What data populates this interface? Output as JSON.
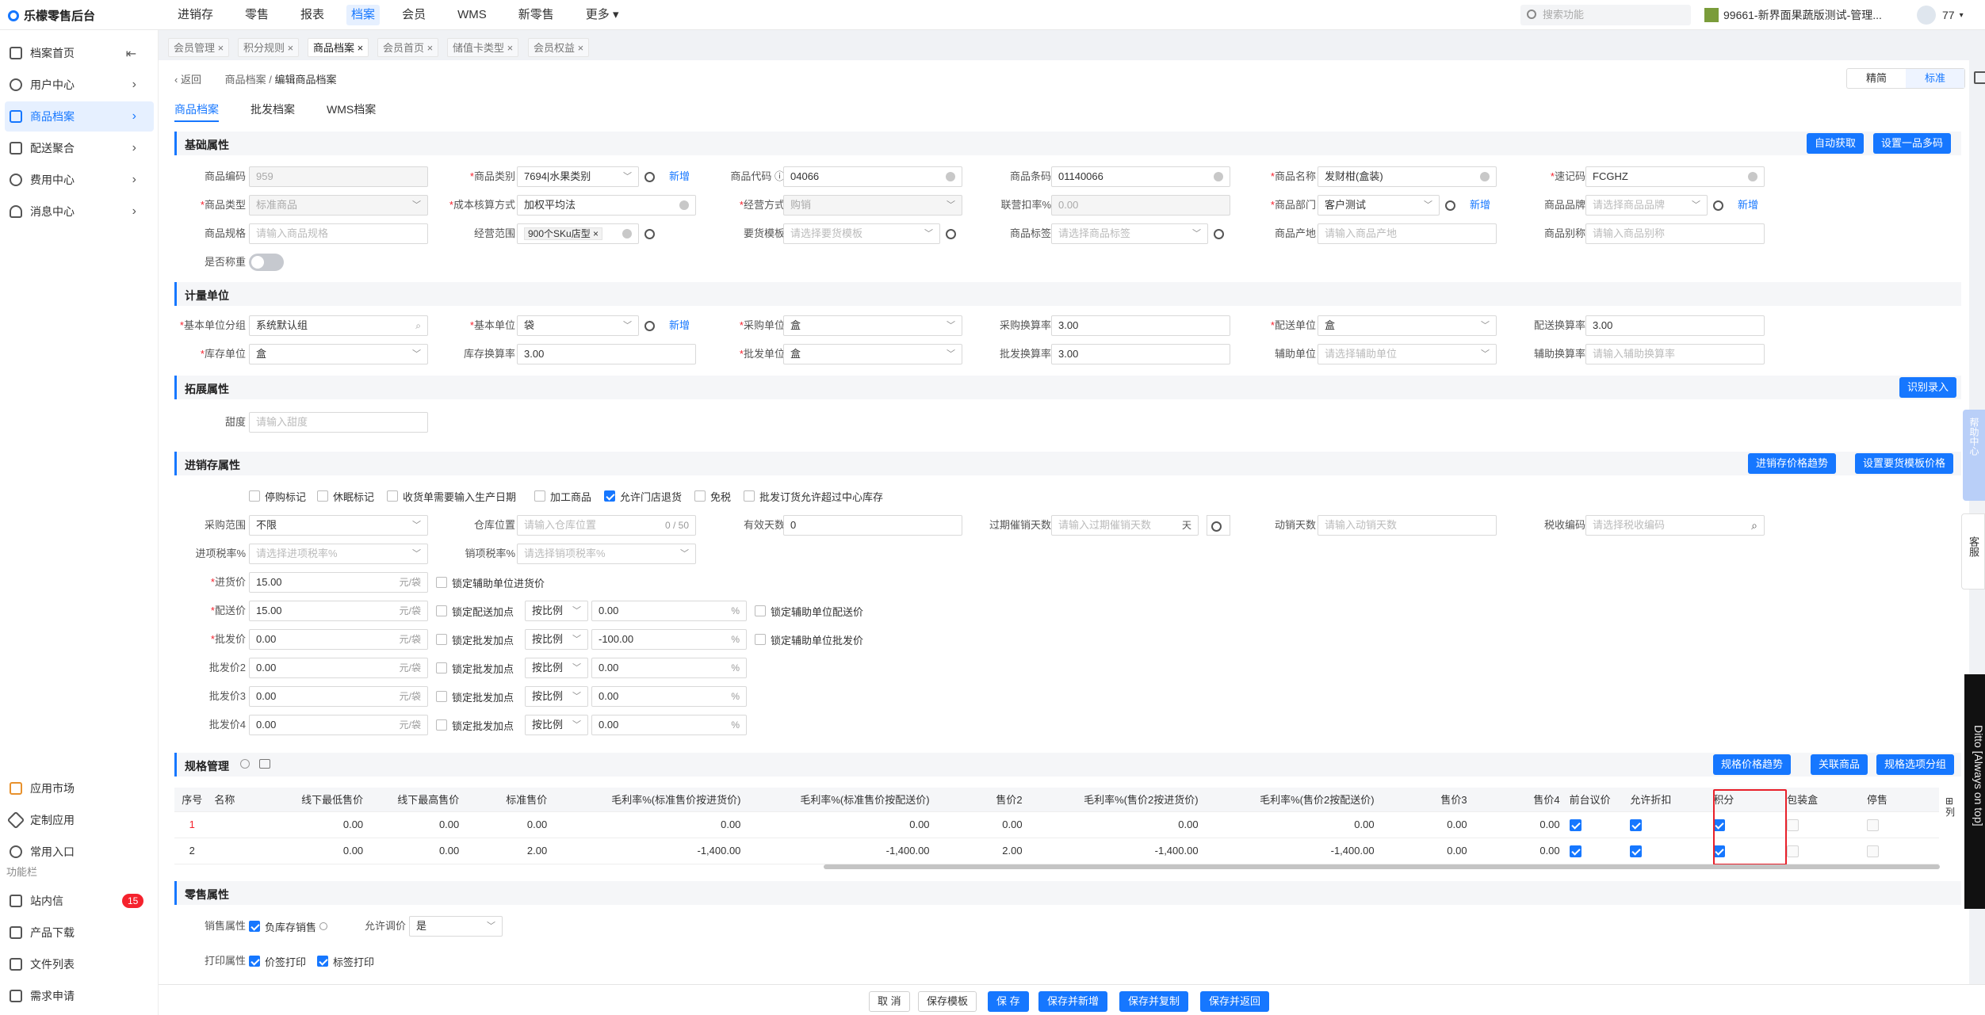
{
  "app": {
    "title": "乐檬零售后台"
  },
  "topnav": [
    "进销存",
    "零售",
    "报表",
    "档案",
    "会员",
    "WMS",
    "新零售",
    "更多"
  ],
  "topnav_active": "档案",
  "search": {
    "placeholder": "搜索功能"
  },
  "store": {
    "name": "99661-新界面果蔬版测试-管理..."
  },
  "user": {
    "name": "77"
  },
  "sidebar": {
    "items": [
      {
        "label": "档案首页"
      },
      {
        "label": "用户中心"
      },
      {
        "label": "商品档案"
      },
      {
        "label": "配送聚合"
      },
      {
        "label": "费用中心"
      },
      {
        "label": "消息中心"
      }
    ],
    "bottom": [
      {
        "label": "应用市场"
      },
      {
        "label": "定制应用"
      },
      {
        "label": "常用入口"
      }
    ],
    "section_label": "功能栏",
    "tools": [
      {
        "label": "站内信",
        "badge": "15"
      },
      {
        "label": "产品下载"
      },
      {
        "label": "文件列表"
      },
      {
        "label": "需求申请"
      }
    ]
  },
  "tabs": [
    "会员管理",
    "积分规则",
    "商品档案",
    "会员首页",
    "储值卡类型",
    "会员权益"
  ],
  "tabs_active": "商品档案",
  "breadcrumb": {
    "back": "返回",
    "parent": "商品档案",
    "sep": "/",
    "current": "编辑商品档案"
  },
  "view_switch": {
    "simple": "精简",
    "standard": "标准"
  },
  "subtabs": [
    "商品档案",
    "批发档案",
    "WMS档案"
  ],
  "sections": {
    "basic": "基础属性",
    "unit": "计量单位",
    "ext": "拓展属性",
    "inv": "进销存属性",
    "spec": "规格管理",
    "retail": "零售属性"
  },
  "buttons": {
    "auto_get": "自动获取",
    "set_multi_code": "设置一品多码",
    "ocr_input": "识别录入",
    "price_trend": "进销存价格趋势",
    "set_template_price": "设置要货模板价格",
    "spec_price_trend": "规格价格趋势",
    "related_goods": "关联商品",
    "spec_option_group": "规格选项分组",
    "add_new": "新增"
  },
  "basic": {
    "code_label": "商品编码",
    "code": "959",
    "category_label": "商品类别",
    "category": "7694|水果类别",
    "gcode_label": "商品代码",
    "gcode": "04066",
    "barcode_label": "商品条码",
    "barcode": "01140066",
    "name_label": "商品名称",
    "name": "发财柑(盒装)",
    "quick_label": "速记码",
    "quick": "FCGHZ",
    "type_label": "商品类型",
    "type": "标准商品",
    "cost_label": "成本核算方式",
    "cost": "加权平均法",
    "manage_label": "经营方式",
    "manage": "购销",
    "joint_label": "联营扣率%",
    "joint": "0.00",
    "dept_label": "商品部门",
    "dept": "客户测试",
    "brand_label": "商品品牌",
    "brand_ph": "请选择商品品牌",
    "spec_label": "商品规格",
    "spec_ph": "请输入商品规格",
    "scope_label": "经营范围",
    "scope": "900个SKu店型",
    "tpl_label": "要货模板",
    "tpl_ph": "请选择要货模板",
    "tag_label": "商品标签",
    "tag_ph": "请选择商品标签",
    "origin_label": "商品产地",
    "origin_ph": "请输入商品产地",
    "alias_label": "商品别称",
    "alias_ph": "请输入商品别称",
    "weigh_label": "是否称重"
  },
  "unit": {
    "group_label": "基本单位分组",
    "group": "系统默认组",
    "base_label": "基本单位",
    "base": "袋",
    "purchase_label": "采购单位",
    "purchase": "盒",
    "purchase_rate_label": "采购换算率",
    "purchase_rate": "3.00",
    "dist_label": "配送单位",
    "dist": "盒",
    "dist_rate_label": "配送换算率",
    "dist_rate": "3.00",
    "stock_label": "库存单位",
    "stock": "盒",
    "stock_rate_label": "库存换算率",
    "stock_rate": "3.00",
    "whole_label": "批发单位",
    "whole": "盒",
    "whole_rate_label": "批发换算率",
    "whole_rate": "3.00",
    "aux_label": "辅助单位",
    "aux_ph": "请选择辅助单位",
    "aux_rate_label": "辅助换算率",
    "aux_rate_ph": "请输入辅助换算率"
  },
  "ext": {
    "sweet_label": "甜度",
    "sweet_ph": "请输入甜度"
  },
  "inv": {
    "checks": [
      {
        "label": "停购标记",
        "on": false
      },
      {
        "label": "休眠标记",
        "on": false
      },
      {
        "label": "收货单需要输入生产日期",
        "on": false
      },
      {
        "label": "加工商品",
        "on": false
      },
      {
        "label": "允许门店退货",
        "on": true
      },
      {
        "label": "免税",
        "on": false
      },
      {
        "label": "批发订货允许超过中心库存",
        "on": false
      }
    ],
    "range_label": "采购范围",
    "range": "不限",
    "loc_label": "仓库位置",
    "loc_ph": "请输入仓库位置",
    "loc_count": "0 / 50",
    "valid_label": "有效天数",
    "valid": "0",
    "expire_label": "过期催销天数",
    "expire_ph": "请输入过期催销天数",
    "expire_unit": "天",
    "move_label": "动销天数",
    "move_ph": "请输入动销天数",
    "tax_label": "税收编码",
    "tax_ph": "请选择税收编码",
    "in_tax_label": "进项税率%",
    "in_tax_ph": "请选择进项税率%",
    "out_tax_label": "销项税率%",
    "out_tax_ph": "请选择销项税率%",
    "in_price_label": "进货价",
    "in_price": "15.00",
    "unit_suffix": "元/袋",
    "lock_aux_in": "锁定辅助单位进货价",
    "dist_price_label": "配送价",
    "dist_price": "15.00",
    "lock_dist_add": "锁定配送加点",
    "ratio": "按比例",
    "dist_add": "0.00",
    "pct": "%",
    "lock_aux_dist": "锁定辅助单位配送价",
    "whole_price_label": "批发价",
    "whole_price": "0.00",
    "lock_whole_add": "锁定批发加点",
    "whole_add": "-100.00",
    "lock_aux_whole": "锁定辅助单位批发价",
    "whole2_label": "批发价2",
    "whole2": "0.00",
    "whole2_add": "0.00",
    "whole3_label": "批发价3",
    "whole3": "0.00",
    "whole3_add": "0.00",
    "whole4_label": "批发价4",
    "whole4": "0.00",
    "whole4_add": "0.00"
  },
  "spec_table": {
    "columns": [
      "序号",
      "名称",
      "线下最低售价",
      "线下最高售价",
      "标准售价",
      "毛利率%(标准售价按进货价)",
      "毛利率%(标准售价按配送价)",
      "售价2",
      "毛利率%(售价2按进货价)",
      "毛利率%(售价2按配送价)",
      "售价3",
      "售价4",
      "前台议价",
      "允许折扣",
      "积分",
      "包装盒",
      "停售"
    ],
    "side_col": "列",
    "rows": [
      {
        "idx": "1",
        "name": "",
        "min": "0.00",
        "max": "0.00",
        "std": "0.00",
        "m1": "0.00",
        "m2": "0.00",
        "p2": "0.00",
        "m3": "0.00",
        "m4": "0.00",
        "p3": "0.00",
        "p4": "0.00",
        "bargain": true,
        "discount": true,
        "points": true,
        "box": false,
        "stop": false
      },
      {
        "idx": "2",
        "name": "",
        "min": "0.00",
        "max": "0.00",
        "std": "2.00",
        "m1": "-1,400.00",
        "m2": "-1,400.00",
        "p2": "2.00",
        "m3": "-1,400.00",
        "m4": "-1,400.00",
        "p3": "0.00",
        "p4": "0.00",
        "bargain": true,
        "discount": true,
        "points": true,
        "box": false,
        "stop": false
      }
    ]
  },
  "retail": {
    "sale_label": "销售属性",
    "neg_stock": "负库存销售",
    "price_adj_label": "允许调价",
    "price_adj": "是",
    "print_label": "打印属性",
    "print_price": "价签打印",
    "print_tag": "标签打印"
  },
  "footer": [
    "取 消",
    "保存模板",
    "保 存",
    "保存并新增",
    "保存并复制",
    "保存并返回"
  ],
  "help": "帮助中心",
  "kefu": "客服",
  "ditto": "Ditto [Always on top]"
}
